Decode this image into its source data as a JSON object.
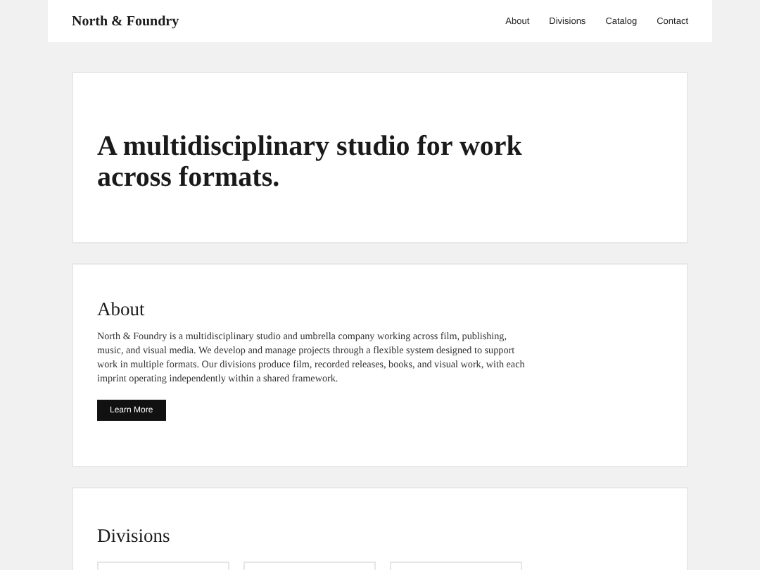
{
  "header": {
    "brand": "North & Foundry",
    "nav": [
      {
        "label": "About"
      },
      {
        "label": "Divisions"
      },
      {
        "label": "Catalog"
      },
      {
        "label": "Contact"
      }
    ]
  },
  "hero": {
    "headline": "A multidisciplinary studio for work across formats."
  },
  "about": {
    "heading": "About",
    "body": "North & Foundry is a multidisciplinary studio and umbrella company working across film, publishing, music, and visual media. We develop and manage projects through a flexible system designed to support work in multiple formats. Our divisions produce film, recorded releases, books, and visual work, with each imprint operating independently within a shared framework.",
    "button": "Learn More"
  },
  "divisions": {
    "heading": "Divisions"
  }
}
